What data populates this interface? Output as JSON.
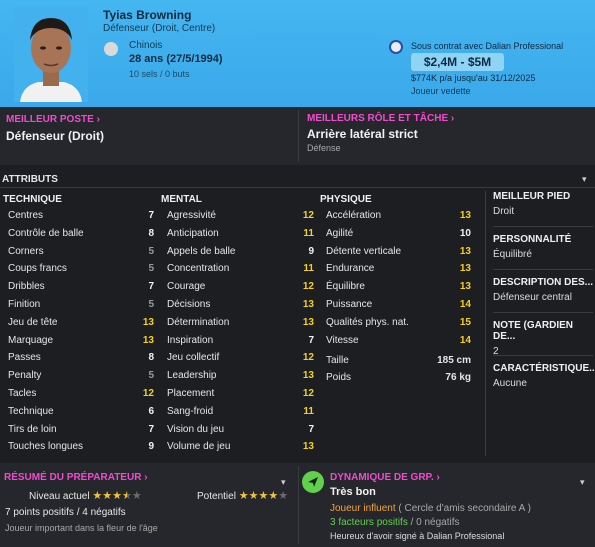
{
  "header": {
    "name": "Tyias Browning",
    "position": "Défenseur (Droit, Centre)",
    "nationality": "Chinois",
    "age": "28 ans",
    "dob": "(27/5/1994)",
    "caps": "10 sels / 0 buts",
    "contract": "Sous contrat avec Dalian Professional",
    "value": "$2,4M - $5M",
    "wage": "$774K p/a jusqu'au 31/12/2025",
    "status": "Joueur vedette"
  },
  "best_position": {
    "title": "MEILLEUR POSTE",
    "value": "Défenseur (Droit)"
  },
  "best_role": {
    "title": "MEILLEURS RÔLE ET TÂCHE",
    "value": "Arrière latéral strict",
    "sub": "Défense"
  },
  "attributes": {
    "title": "ATTRIBUTS",
    "technique": {
      "title": "TECHNIQUE",
      "rows": [
        {
          "label": "Centres",
          "value": "7",
          "color": "w"
        },
        {
          "label": "Contrôle de balle",
          "value": "8",
          "color": "w"
        },
        {
          "label": "Corners",
          "value": "5",
          "color": "g"
        },
        {
          "label": "Coups francs",
          "value": "5",
          "color": "g"
        },
        {
          "label": "Dribbles",
          "value": "7",
          "color": "w"
        },
        {
          "label": "Finition",
          "value": "5",
          "color": "g"
        },
        {
          "label": "Jeu de tête",
          "value": "13",
          "color": "y"
        },
        {
          "label": "Marquage",
          "value": "13",
          "color": "y"
        },
        {
          "label": "Passes",
          "value": "8",
          "color": "w"
        },
        {
          "label": "Penalty",
          "value": "5",
          "color": "g"
        },
        {
          "label": "Tacles",
          "value": "12",
          "color": "y"
        },
        {
          "label": "Technique",
          "value": "6",
          "color": "w"
        },
        {
          "label": "Tirs de loin",
          "value": "7",
          "color": "w"
        },
        {
          "label": "Touches longues",
          "value": "9",
          "color": "w"
        }
      ]
    },
    "mental": {
      "title": "MENTAL",
      "rows": [
        {
          "label": "Agressivité",
          "value": "12",
          "color": "y"
        },
        {
          "label": "Anticipation",
          "value": "11",
          "color": "y"
        },
        {
          "label": "Appels de balle",
          "value": "9",
          "color": "w"
        },
        {
          "label": "Concentration",
          "value": "11",
          "color": "y"
        },
        {
          "label": "Courage",
          "value": "12",
          "color": "y"
        },
        {
          "label": "Décisions",
          "value": "13",
          "color": "y"
        },
        {
          "label": "Détermination",
          "value": "13",
          "color": "y"
        },
        {
          "label": "Inspiration",
          "value": "7",
          "color": "w"
        },
        {
          "label": "Jeu collectif",
          "value": "12",
          "color": "y"
        },
        {
          "label": "Leadership",
          "value": "13",
          "color": "y"
        },
        {
          "label": "Placement",
          "value": "12",
          "color": "y"
        },
        {
          "label": "Sang-froid",
          "value": "11",
          "color": "y"
        },
        {
          "label": "Vision du jeu",
          "value": "7",
          "color": "w"
        },
        {
          "label": "Volume de jeu",
          "value": "13",
          "color": "y"
        }
      ]
    },
    "physique": {
      "title": "PHYSIQUE",
      "rows": [
        {
          "label": "Accélération",
          "value": "13",
          "color": "y"
        },
        {
          "label": "Agilité",
          "value": "10",
          "color": "w"
        },
        {
          "label": "Détente verticale",
          "value": "13",
          "color": "y"
        },
        {
          "label": "Endurance",
          "value": "13",
          "color": "y"
        },
        {
          "label": "Équilibre",
          "value": "13",
          "color": "y"
        },
        {
          "label": "Puissance",
          "value": "14",
          "color": "y"
        },
        {
          "label": "Qualités phys. nat.",
          "value": "15",
          "color": "y"
        },
        {
          "label": "Vitesse",
          "value": "14",
          "color": "y"
        }
      ],
      "height_label": "Taille",
      "height": "185 cm",
      "weight_label": "Poids",
      "weight": "76 kg"
    }
  },
  "side": [
    {
      "title": "MEILLEUR PIED",
      "value": "Droit"
    },
    {
      "title": "PERSONNALITÉ",
      "value": "Équilibré"
    },
    {
      "title": "DESCRIPTION DES...",
      "value": "Défenseur central"
    },
    {
      "title": "NOTE (GARDIEN DE...",
      "value": "2"
    },
    {
      "title": "CARACTÉRISTIQUE...",
      "value": "Aucune"
    }
  ],
  "coach": {
    "title": "RÉSUMÉ DU PRÉPARATEUR",
    "current_label": "Niveau actuel",
    "current_stars": 3.5,
    "potential_label": "Potentiel",
    "potential_stars": 4,
    "points": "7 points positifs / 4 négatifs",
    "desc": "Joueur important dans la fleur de l'âge"
  },
  "dynamics": {
    "title": "DYNAMIQUE DE GRP.",
    "value": "Très bon",
    "influence": "Joueur influent",
    "circle": "( Cercle d'amis secondaire A )",
    "positive": "3 facteurs positifs",
    "negative": "/ 0 négatifs",
    "note": "Heureux d'avoir signé à Dalian Professional"
  },
  "colors": {
    "accent": "#f04bd0",
    "header": "#3aa8ea",
    "yellow": "#f7d21a",
    "orange": "#f0a43a",
    "green": "#5fd14a"
  }
}
